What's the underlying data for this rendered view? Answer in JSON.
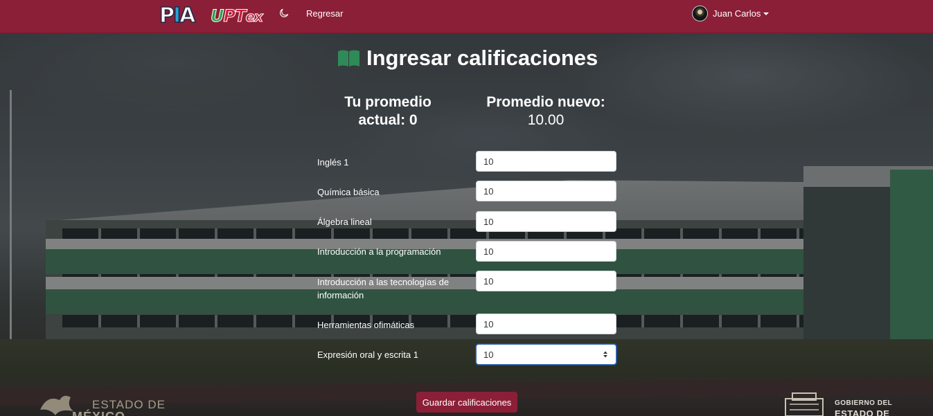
{
  "navbar": {
    "logo_pia": "PIA",
    "logo_upt": "UPTex",
    "theme_toggle_icon": "moon-icon",
    "back_link": "Regresar",
    "user_name": "Juan Carlos",
    "brand_color": "#8b1f37"
  },
  "main": {
    "title": "Ingresar calificaciones",
    "title_icon": "book-icon",
    "current_average": {
      "label": "Tu promedio actual:",
      "value": "0"
    },
    "new_average": {
      "label": "Promedio nuevo:",
      "value": "10.00"
    },
    "grades": [
      {
        "subject": "Inglés 1",
        "value": "10"
      },
      {
        "subject": "Química básica",
        "value": "10"
      },
      {
        "subject": "Álgebra lineal",
        "value": "10"
      },
      {
        "subject": "Introducción a la programación",
        "value": "10"
      },
      {
        "subject": "Introducción a las tecnologías de información",
        "value": "10"
      },
      {
        "subject": "Herramientas ofimáticas",
        "value": "10"
      },
      {
        "subject": "Expresión oral y escrita 1",
        "value": "10"
      }
    ],
    "save_button": "Guardar calificaciones"
  },
  "footer": {
    "estado_logo_line1": "ESTADO DE",
    "estado_logo_line2": "MÉXICO",
    "gobierno_line1": "GOBIERNO DEL",
    "gobierno_line2": "ESTADO DE"
  }
}
